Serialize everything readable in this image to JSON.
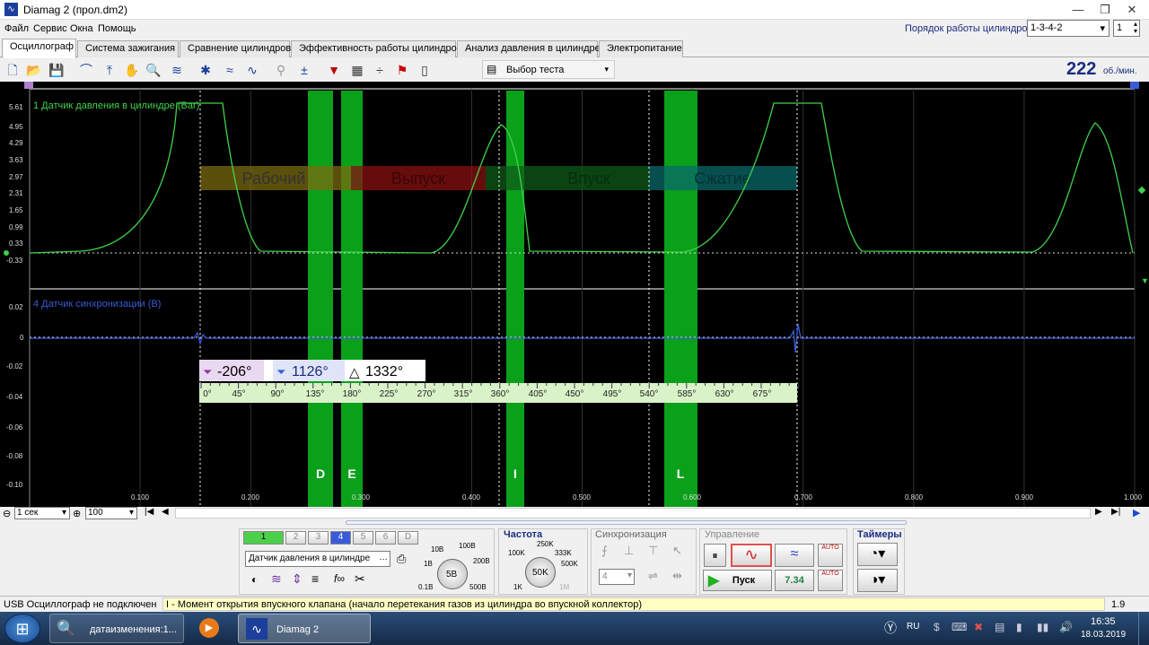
{
  "window": {
    "title": "Diamag 2 (прол.dm2)",
    "min": "—",
    "max": "❐",
    "close": "✕"
  },
  "menu": [
    "Файл",
    "Сервис",
    "Окна",
    "Помощь"
  ],
  "cylinder_order": {
    "label": "Порядок работы цилиндров",
    "value": "1-3-4-2",
    "cylinder": "1"
  },
  "tabs": [
    "Осциллограф",
    "Система зажигания",
    "Сравнение цилиндров",
    "Эффективность работы цилиндров",
    "Анализ давления в цилиндре",
    "Электропитание"
  ],
  "toolbar": {
    "test_select": "Выбор теста",
    "rpm": "222",
    "rpm_unit": "об./мин."
  },
  "scope": {
    "channel1_label": "1 Датчик давления в цилиндре (Bar)",
    "channel4_label": "4 Датчик синхронизации (В)",
    "y1_ticks": [
      "5.61",
      "4.95",
      "4.29",
      "3.63",
      "2.97",
      "2.31",
      "1.65",
      "0.99",
      "0.33",
      "-0.33"
    ],
    "y2_ticks": [
      "0.02",
      "0",
      "-0.02",
      "-0.04",
      "-0.06",
      "-0.08",
      "-0.10"
    ],
    "x_ticks": [
      "0.100",
      "0.200",
      "0.300",
      "0.400",
      "0.500",
      "0.600",
      "0.700",
      "0.800",
      "0.900",
      "1.000"
    ],
    "phases": [
      {
        "label": "Рабочий",
        "color": "#7a6a10"
      },
      {
        "label": "Выпуск",
        "color": "#8a1010"
      },
      {
        "label": "Впуск",
        "color": "#0f5a1a"
      },
      {
        "label": "Сжатие",
        "color": "#0a6a6a"
      }
    ],
    "markers": [
      "D",
      "E",
      "I",
      "L"
    ],
    "cursor1": "-206°",
    "cursor2": "1126°",
    "delta": "1332°",
    "degree_scale": [
      "0°",
      "45°",
      "90°",
      "135°",
      "180°",
      "225°",
      "270°",
      "315°",
      "360°",
      "405°",
      "450°",
      "495°",
      "540°",
      "585°",
      "630°",
      "675°"
    ]
  },
  "timebase": {
    "value": "1 сек",
    "zoom": "100"
  },
  "channels": {
    "buttons": [
      "1",
      "2",
      "3",
      "4",
      "5",
      "6",
      "D"
    ],
    "sensor": "Датчик давления в цилиндре",
    "knob_labels": [
      "10В",
      "100В",
      "1В",
      "200В",
      "0.1В",
      "500В"
    ],
    "knob_value": "5В"
  },
  "frequency": {
    "title": "Частота",
    "labels": [
      "250K",
      "100K",
      "333K",
      "500K",
      "1K",
      "1M"
    ],
    "value": "50K"
  },
  "sync": {
    "title": "Синхронизация",
    "channel": "4"
  },
  "control": {
    "title": "Управление",
    "start": "Пуск",
    "value": "7.34"
  },
  "timers": {
    "title": "Таймеры"
  },
  "status": {
    "usb": "USB Осциллограф не подключен",
    "message": "I - Момент открытия впускного клапана (начало перетекания газов из цилиндра во впускной коллектор)",
    "version": "1.9"
  },
  "taskbar": {
    "item1": "датаизменения:1...",
    "item3": "Diamag 2",
    "lang": "RU",
    "time": "16:35",
    "date": "18.03.2019"
  },
  "colors": {
    "trace1": "#3fd34a",
    "trace2": "#3a5bd9",
    "marker": "#0aa01a",
    "accent": "#1a2d80"
  }
}
